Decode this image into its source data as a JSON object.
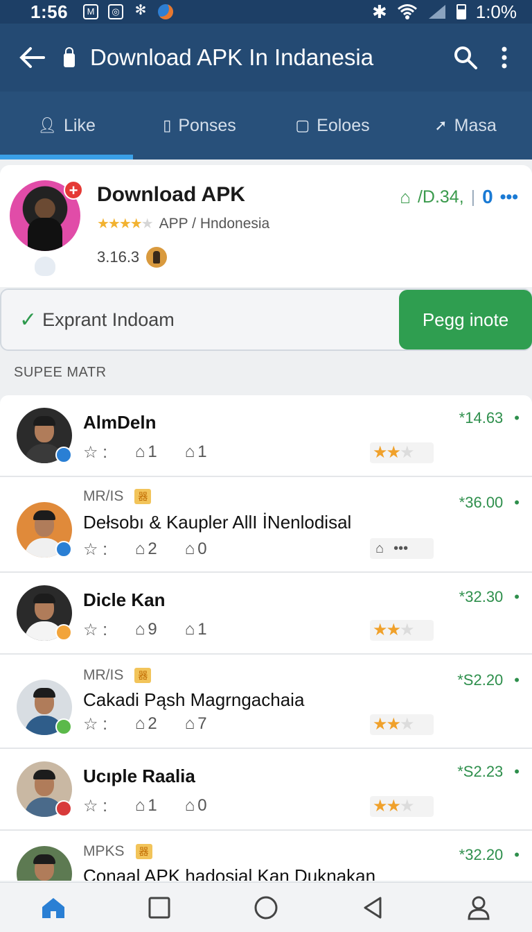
{
  "status_bar": {
    "time": "1:56",
    "battery": "1:0%",
    "notification_icons": [
      "mail-icon",
      "app-icon",
      "bluetooth-icon",
      "browser-icon"
    ],
    "right_icons": [
      "bluetooth-icon",
      "wifi-icon",
      "signal-icon",
      "battery-icon"
    ]
  },
  "app_bar": {
    "title": "Download APK In Indanesia",
    "icons": [
      "back-arrow-icon",
      "lock-icon",
      "search-icon",
      "more-vert-icon"
    ]
  },
  "tabs": [
    {
      "label": "Like",
      "icon": "person-icon",
      "active": true
    },
    {
      "label": "Ponses",
      "icon": "phone-icon",
      "active": false
    },
    {
      "label": "Eoloes",
      "icon": "tablet-icon",
      "active": false
    },
    {
      "label": "Masa",
      "icon": "send-icon",
      "active": false
    }
  ],
  "app_header": {
    "name": "Download APK",
    "subtitle": "APP / Hndonesia",
    "rating_stars": 3.5,
    "version": "3.16.3",
    "stat": "/D.34,",
    "stat_separator": "|",
    "count": "0",
    "more": "•••"
  },
  "action_bar": {
    "label": "Exprant Indoam",
    "button": "Pegg inote"
  },
  "section_title": "SUPEE MATR",
  "rows": [
    {
      "tag_text": "",
      "name": "AlmDeln",
      "bold": true,
      "star_sep": ":",
      "likes": "1",
      "shares": "1",
      "price": "*14.63",
      "dot": "•",
      "stars": 2,
      "badge": "#2a7fd4"
    },
    {
      "tag_text": "MR/IS",
      "name": "Dełsobı & Kaupler AllI İNenlodisal",
      "bold": false,
      "star_sep": ":",
      "likes": "2",
      "shares": "0",
      "price": "*36.00",
      "dot": "•",
      "stars": null,
      "badge": "#2a7fd4"
    },
    {
      "tag_text": "",
      "name": "Dicle Kan",
      "bold": true,
      "star_sep": ":",
      "likes": "9",
      "shares": "1",
      "price": "*32.30",
      "dot": "•",
      "stars": 2,
      "badge": "#f2a43a"
    },
    {
      "tag_text": "MR/IS",
      "name": "Cakadi Pąsh Magrngachaia",
      "bold": false,
      "star_sep": ":",
      "likes": "2",
      "shares": "7",
      "price": "*S2.20",
      "dot": "•",
      "stars": 2,
      "badge": "#5bb94a"
    },
    {
      "tag_text": "",
      "name": "Ucıple Raalia",
      "bold": true,
      "star_sep": ":",
      "likes": "1",
      "shares": "0",
      "price": "*S2.23",
      "dot": "•",
      "stars": 2,
      "badge": "#d83a3a"
    },
    {
      "tag_text": "MPKS",
      "name": "Conaal APK hadosial Kan Duknakan",
      "bold": false,
      "star_sep": "",
      "likes": "",
      "shares": "",
      "price": "*32.20",
      "dot": "•",
      "stars": null,
      "badge": ""
    }
  ],
  "bottom_nav": [
    "home-icon",
    "square-icon",
    "circle-icon",
    "back-triangle-icon",
    "profile-icon"
  ],
  "colors": {
    "status_bar": "#1d3f66",
    "app_bar": "#244a73",
    "tab_bar": "#28507a",
    "tab_indicator": "#3aa0e8",
    "primary_button": "#2f9e50",
    "price": "#2e8f4c",
    "star": "#f0a12b"
  }
}
